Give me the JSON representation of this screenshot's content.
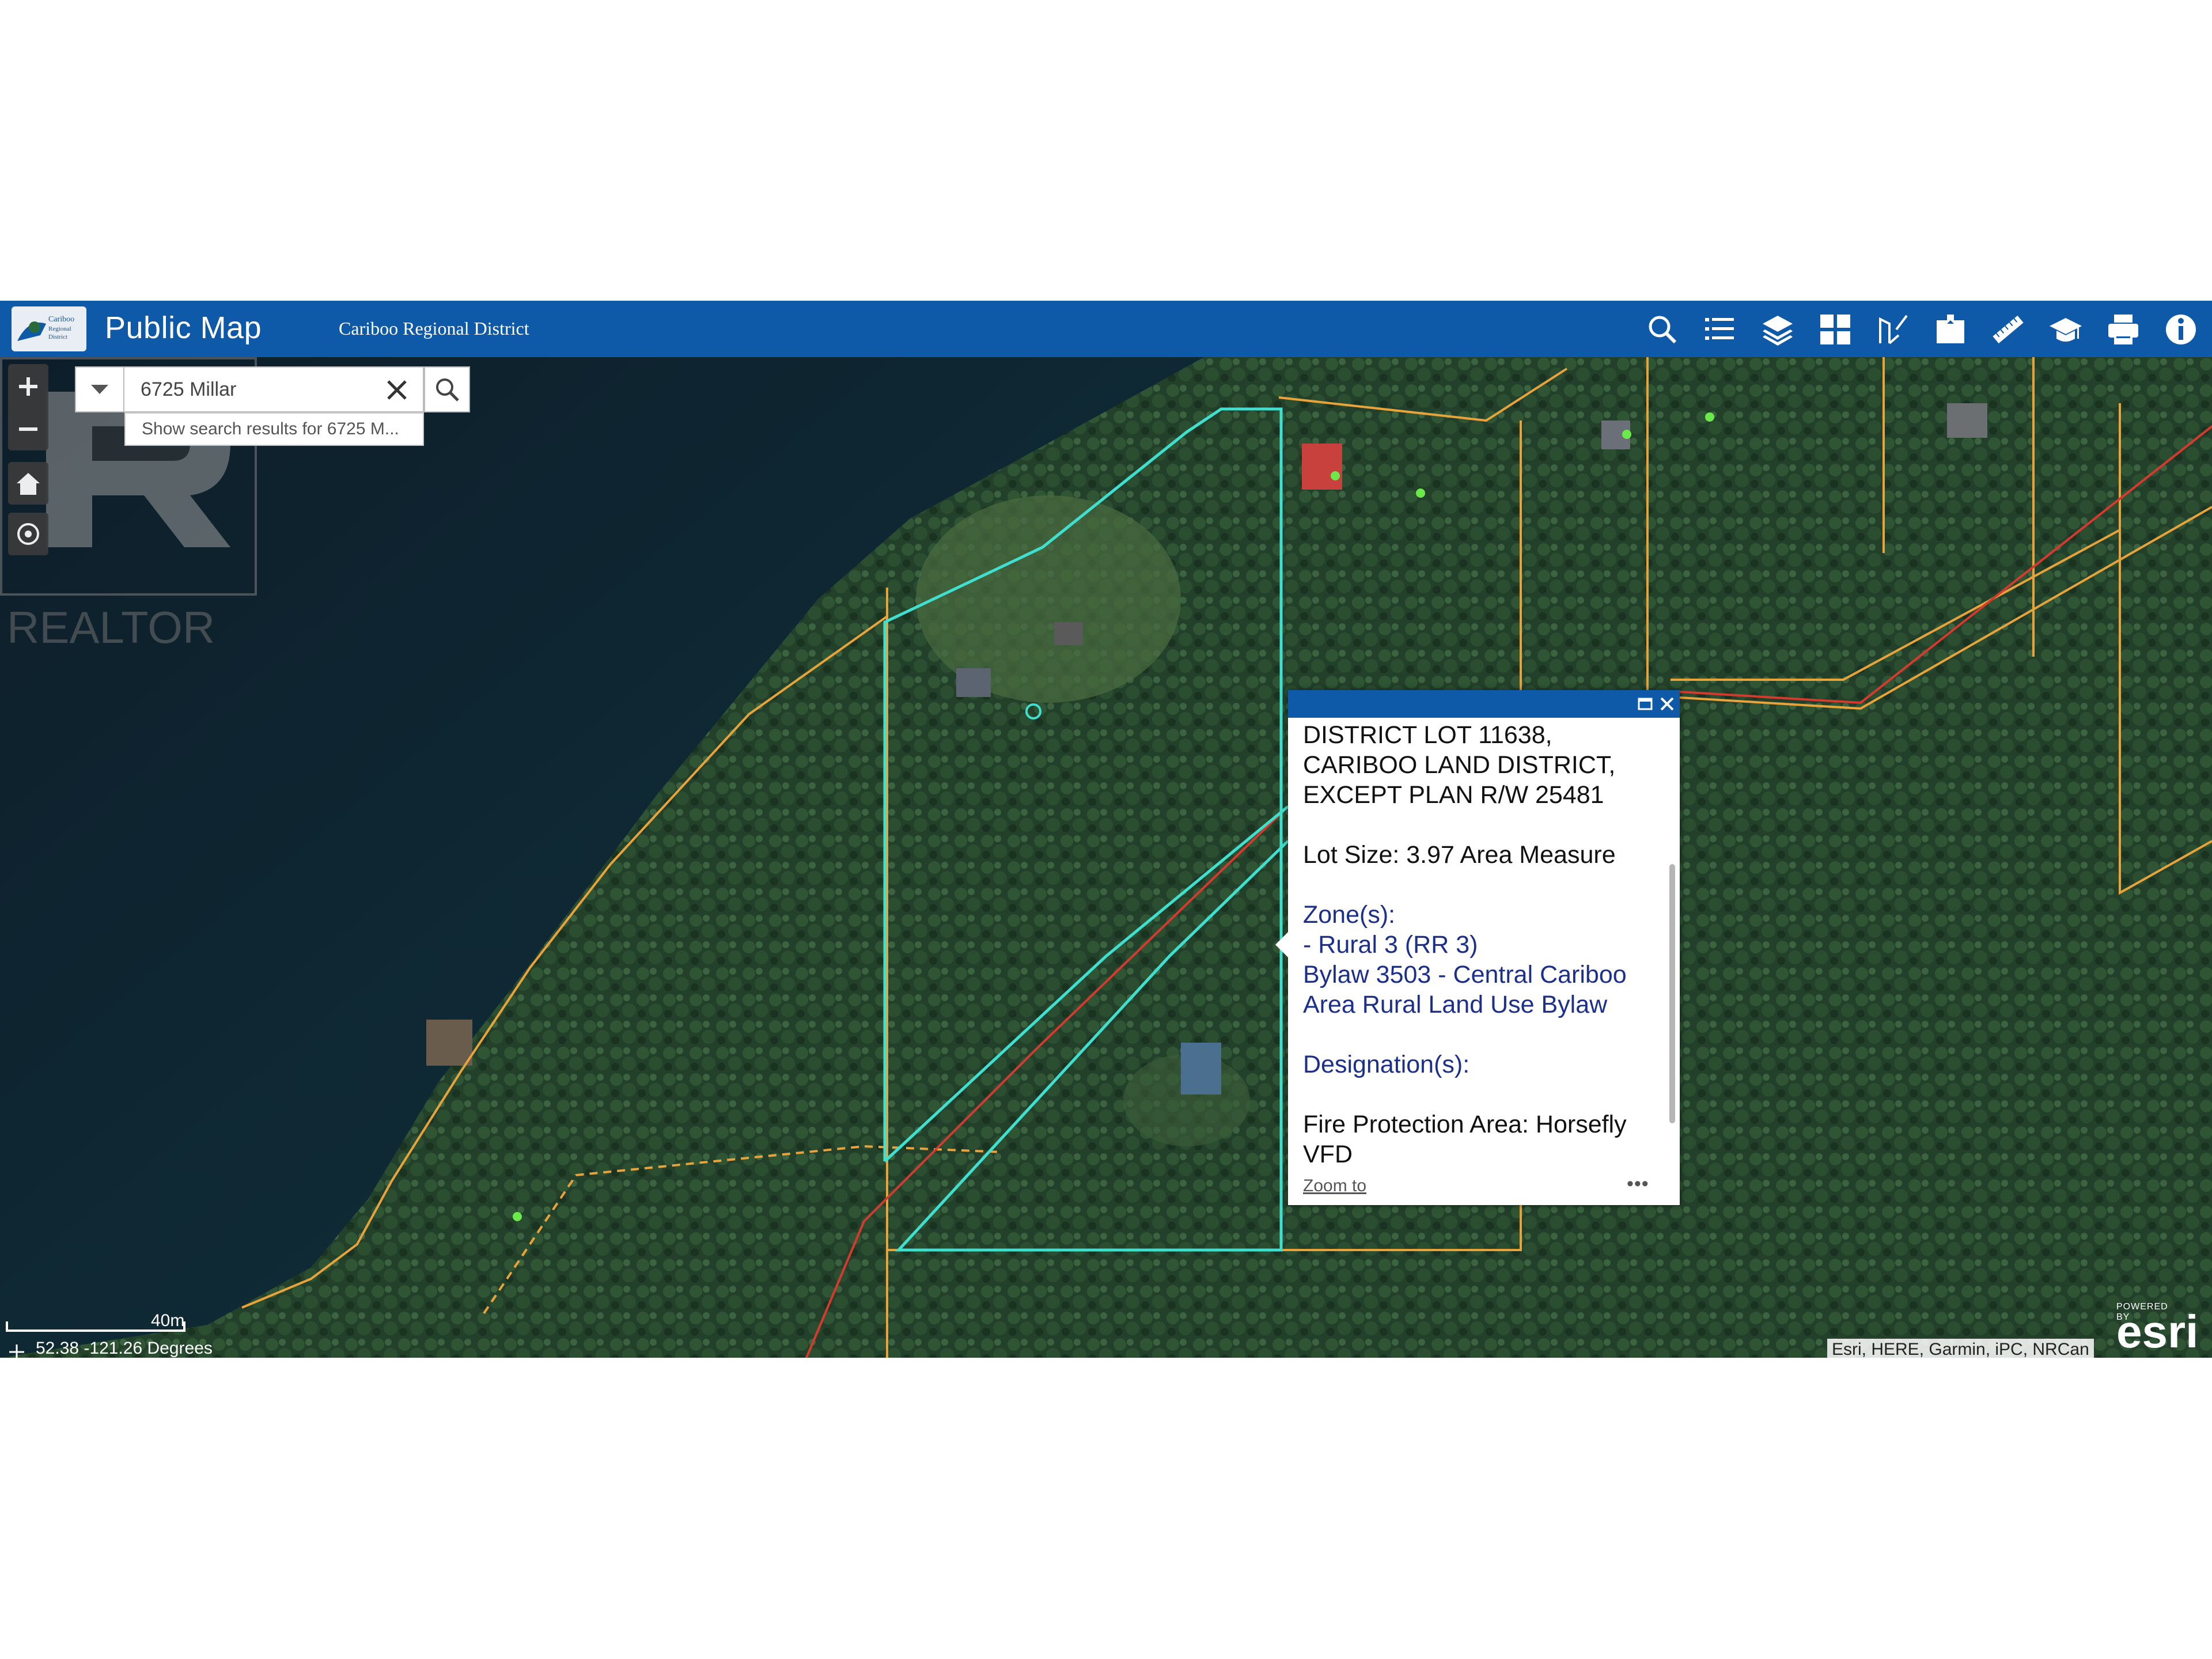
{
  "header": {
    "app_title": "Public Map",
    "org_name": "Cariboo Regional District",
    "logo_text": "Cariboo Regional District",
    "brand_color": "#0e5aa8",
    "toolbar_icons": [
      "search-icon",
      "list-icon",
      "layers-icon",
      "basemap-grid-icon",
      "draw-icon",
      "bookmark-icon",
      "measure-icon",
      "education-icon",
      "print-icon",
      "info-icon"
    ]
  },
  "search": {
    "value": "6725 Millar",
    "suggestion": "Show search results for 6725 M..."
  },
  "watermark": {
    "text": "REALTOR"
  },
  "popup": {
    "legal_line1": "DISTRICT LOT 11638,",
    "legal_line2": "CARIBOO LAND DISTRICT,",
    "legal_line3": "EXCEPT PLAN R/W 25481",
    "lot_size": "Lot Size: 3.97 Area Measure",
    "zones_heading": "Zone(s):",
    "zone_line1": "- Rural 3 (RR 3)",
    "zone_line2": "Bylaw 3503 - Central Cariboo",
    "zone_line3": "Area Rural Land Use Bylaw",
    "designations_heading": "Designation(s):",
    "fire_line1": "Fire Protection Area: Horsefly",
    "fire_line2": "VFD",
    "zoom_to": "Zoom to",
    "more": "•••"
  },
  "map": {
    "coordinates": "52.38 -121.26 Degrees",
    "scale": "40m",
    "attribution": "Esri, HERE, Garmin, iPC, NRCan",
    "esri_powered": "POWERED BY",
    "esri_word": "esri",
    "parcel_color": "#3fe0d0",
    "lot_line_color": "#e8a33a",
    "road_color": "#d43a2e"
  }
}
